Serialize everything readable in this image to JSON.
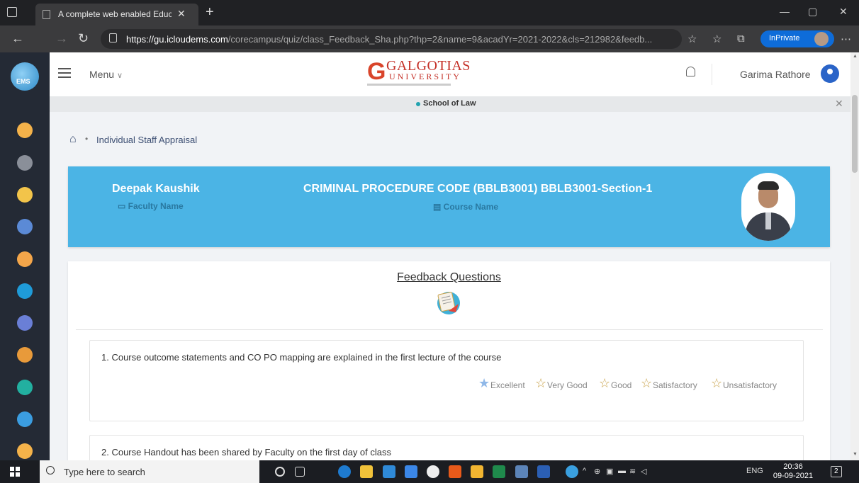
{
  "browser": {
    "tab_title": "A complete web enabled Educati",
    "url_host": "https://gu.icloudems.com",
    "url_path": "/corecampus/quiz/class_Feedback_Sha.php?thp=2&name=9&acadYr=2021-2022&cls=212982&feedb...",
    "inprivate_label": "InPrivate"
  },
  "header": {
    "menu_label": "Menu",
    "brand_line1": "GALGOTIAS",
    "brand_line2": "UNIVERSITY",
    "user_name": "Garima Rathore"
  },
  "school_bar": {
    "label": "School of Law"
  },
  "breadcrumb": {
    "label": "Individual Staff Appraisal"
  },
  "banner": {
    "faculty_name": "Deepak Kaushik",
    "faculty_label": "Faculty Name",
    "course_name": "CRIMINAL PROCEDURE CODE (BBLB3001) BBLB3001-Section-1",
    "course_label": "Course Name"
  },
  "feedback": {
    "heading": "Feedback Questions",
    "questions": [
      {
        "text": "1. Course outcome statements and CO PO mapping are explained in the first lecture of the course",
        "selected": "Excellent"
      },
      {
        "text": "2. Course Handout has been shared by Faculty on the first day of class"
      }
    ],
    "ratings": [
      "Excellent",
      "Very Good",
      "Good",
      "Satisfactory",
      "Unsatisfactory"
    ]
  },
  "taskbar": {
    "search_placeholder": "Type here to search",
    "lang": "ENG",
    "time": "20:36",
    "date": "09-09-2021",
    "notif_count": "2"
  },
  "colors": {
    "banner": "#4bb4e5",
    "accent": "#0e6cd9",
    "sidebar": "#242a35"
  }
}
